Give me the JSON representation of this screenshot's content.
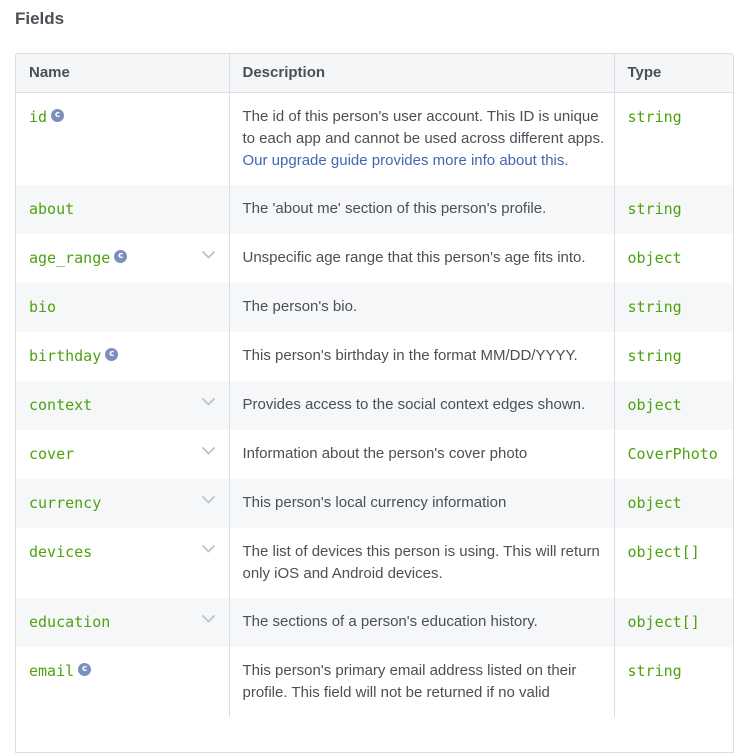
{
  "section_title": "Fields",
  "columns": {
    "name": "Name",
    "description": "Description",
    "type": "Type"
  },
  "rows": [
    {
      "name": "id",
      "badge": "c",
      "desc": "The id of this person's user account. This ID is unique to each app and cannot be used across different apps. ",
      "link": "Our upgrade guide provides more info about this",
      "desc_after": ".",
      "type": "string"
    },
    {
      "name": "about",
      "desc": "The 'about me' section of this person's profile.",
      "type": "string"
    },
    {
      "name": "age_range",
      "badge": "c",
      "expandable": true,
      "desc": "Unspecific age range that this person's age fits into.",
      "type": "object"
    },
    {
      "name": "bio",
      "desc": "The person's bio.",
      "type": "string"
    },
    {
      "name": "birthday",
      "badge": "c",
      "desc": "This person's birthday in the format MM/DD/YYYY.",
      "type": "string"
    },
    {
      "name": "context",
      "expandable": true,
      "desc": "Provides access to the social context edges shown.",
      "type": "object"
    },
    {
      "name": "cover",
      "expandable": true,
      "desc": "Information about the person's cover photo",
      "type": "CoverPhoto"
    },
    {
      "name": "currency",
      "expandable": true,
      "desc": "This person's local currency information",
      "type": "object"
    },
    {
      "name": "devices",
      "expandable": true,
      "desc": "The list of devices this person is using. This will return only iOS and Android devices.",
      "type": "object[]"
    },
    {
      "name": "education",
      "expandable": true,
      "desc": "The sections of a person's education history.",
      "type": "object[]"
    },
    {
      "name": "email",
      "badge": "c",
      "desc": "This person's primary email address listed on their profile. This field will not be returned if no valid",
      "type": "string"
    }
  ],
  "icons": {
    "badge": "c-badge-icon",
    "expand": "chevron-down-icon"
  },
  "colors": {
    "code": "#4ca30d",
    "link": "#4267b2",
    "badge": "#7b8fbf",
    "border": "#dadde1"
  }
}
